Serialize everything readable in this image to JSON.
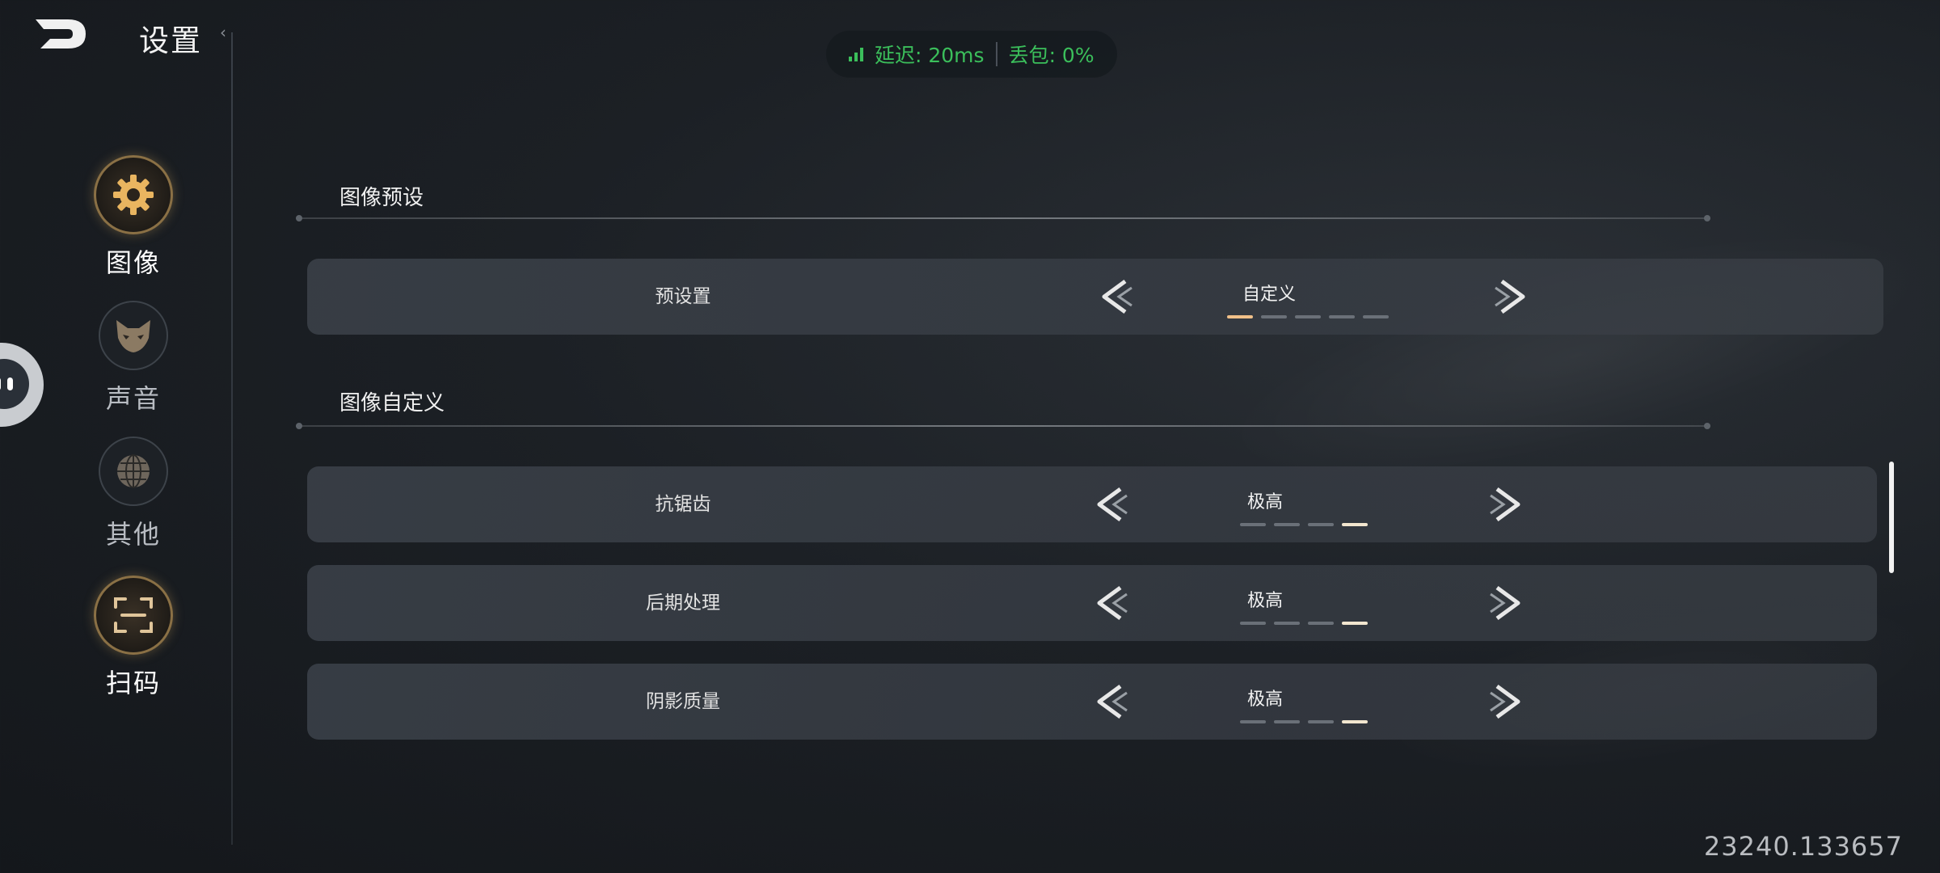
{
  "header": {
    "title": "设置",
    "back_icon": "back-arrow-icon",
    "collapse_icon": "chevron-left-icon"
  },
  "network": {
    "latency": "延迟: 20ms",
    "packet_loss": "丢包: 0%",
    "status_color": "#3bbf5b"
  },
  "sidebar": {
    "items": [
      {
        "label": "图像",
        "icon": "gear-icon",
        "active": true
      },
      {
        "label": "声音",
        "icon": "cat-mask-icon",
        "active": false
      },
      {
        "label": "其他",
        "icon": "globe-icon",
        "active": false
      },
      {
        "label": "扫码",
        "icon": "scan-icon",
        "active": false
      }
    ]
  },
  "sections": [
    {
      "title": "图像预设",
      "rows": [
        {
          "label": "预设置",
          "value": "自定义",
          "levels": 5,
          "selected_level": 1
        }
      ]
    },
    {
      "title": "图像自定义",
      "rows": [
        {
          "label": "抗锯齿",
          "value": "极高",
          "levels": 4,
          "selected_level": 4
        },
        {
          "label": "后期处理",
          "value": "极高",
          "levels": 4,
          "selected_level": 4
        },
        {
          "label": "阴影质量",
          "value": "极高",
          "levels": 4,
          "selected_level": 4
        }
      ]
    }
  ],
  "footer": {
    "readout": "23240.133657"
  },
  "colors": {
    "accent_gold": "#8a7045",
    "level_active": "#f2e6cf",
    "level_active_warm": "#f0c089"
  }
}
